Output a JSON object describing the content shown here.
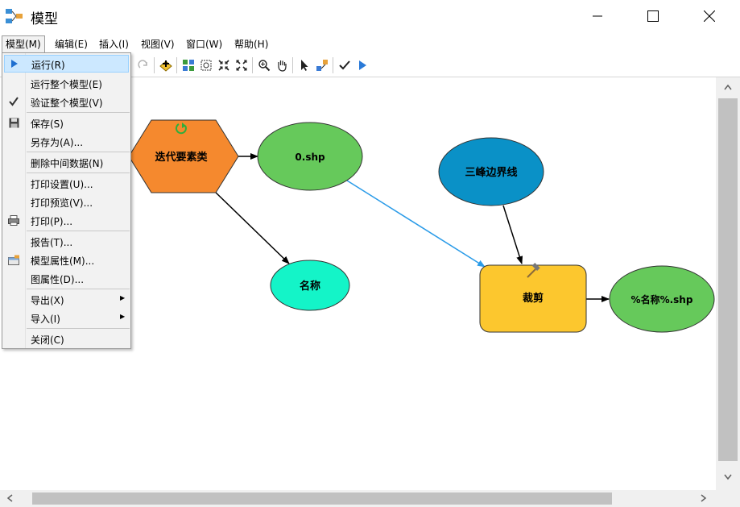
{
  "window": {
    "title": "模型"
  },
  "menubar": [
    {
      "label": "模型(M)"
    },
    {
      "label": "编辑(E)"
    },
    {
      "label": "插入(I)"
    },
    {
      "label": "视图(V)"
    },
    {
      "label": "窗口(W)"
    },
    {
      "label": "帮助(H)"
    }
  ],
  "dropdown": {
    "items": [
      {
        "label": "运行(R)",
        "icon": "run-icon"
      },
      {
        "label": "运行整个模型(E)"
      },
      {
        "label": "验证整个模型(V)",
        "icon": "check-icon"
      },
      {
        "label": "保存(S)",
        "icon": "save-icon"
      },
      {
        "label": "另存为(A)..."
      },
      {
        "label": "删除中间数据(N)"
      },
      {
        "label": "打印设置(U)..."
      },
      {
        "label": "打印预览(V)..."
      },
      {
        "label": "打印(P)...",
        "icon": "printer-icon"
      },
      {
        "label": "报告(T)..."
      },
      {
        "label": "模型属性(M)...",
        "icon": "model-properties-icon"
      },
      {
        "label": "图属性(D)..."
      },
      {
        "label": "导出(X)",
        "submenu": true
      },
      {
        "label": "导入(I)",
        "submenu": true
      },
      {
        "label": "关闭(C)"
      }
    ]
  },
  "diagram": {
    "nodes": {
      "iterate": {
        "label": "迭代要素类",
        "color": "#f5892e"
      },
      "shp0": {
        "label": "0.shp",
        "color": "#66c95b"
      },
      "name": {
        "label": "名称",
        "color": "#14f4c8"
      },
      "boundary": {
        "label": "三峰边界线",
        "color": "#0a91c7"
      },
      "clip": {
        "label": "裁剪",
        "color": "#fcc72e"
      },
      "output": {
        "label": "%名称%.shp",
        "color": "#66c95b"
      }
    }
  },
  "colors": {
    "highlight": "#cce8ff",
    "connector_blue": "#2a9be8"
  }
}
